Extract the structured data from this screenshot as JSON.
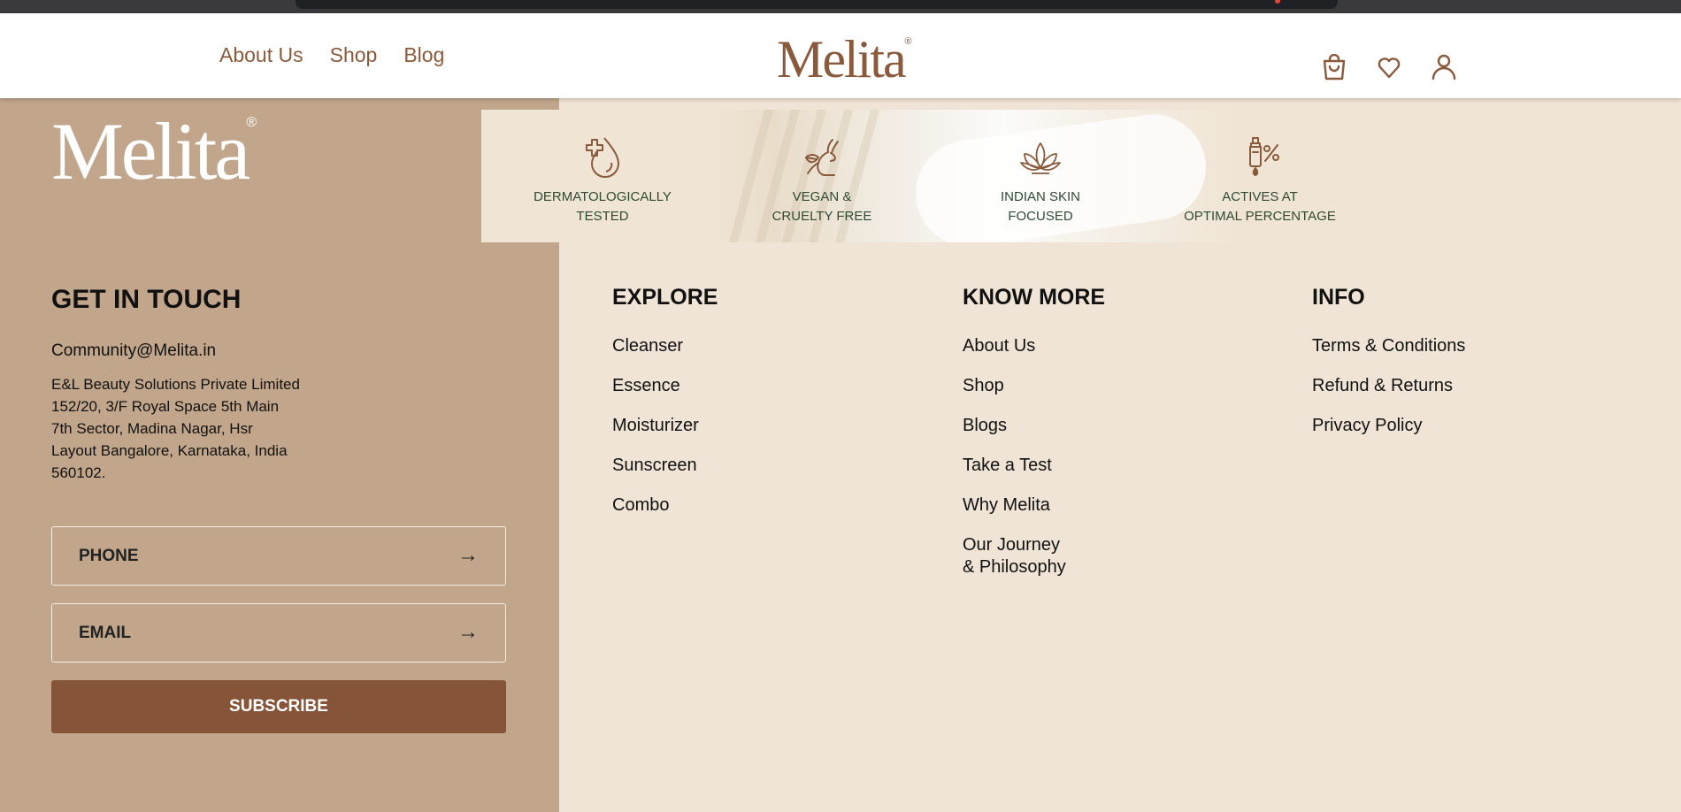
{
  "header": {
    "nav": [
      "About Us",
      "Shop",
      "Blog"
    ],
    "logo": "Melita",
    "logo_mark": "®",
    "icons": [
      "shopping-bag-icon",
      "heart-icon",
      "user-icon"
    ]
  },
  "footer": {
    "logo": "Melita",
    "logo_mark": "®",
    "get_in_touch": {
      "title": "GET IN TOUCH",
      "email": "Community@Melita.in",
      "address": "E&L Beauty Solutions Private Limited\n152/20, 3/F Royal Space 5th Main\n7th Sector, Madina Nagar, Hsr\nLayout Bangalore, Karnataka, India\n560102.",
      "phone_placeholder": "PHONE",
      "email_placeholder": "EMAIL",
      "arrow": "→",
      "subscribe_label": "SUBSCRIBE"
    },
    "badges": [
      {
        "icon": "drop-plus-icon",
        "label": "DERMATOLOGICALLY\nTESTED"
      },
      {
        "icon": "rabbit-icon",
        "label": "VEGAN &\nCRUELTY FREE"
      },
      {
        "icon": "lotus-icon",
        "label": "INDIAN SKIN\nFOCUSED"
      },
      {
        "icon": "dropper-percent-icon",
        "label": "ACTIVES AT\nOPTIMAL PERCENTAGE"
      }
    ],
    "explore": {
      "title": "EXPLORE",
      "links": [
        "Cleanser",
        "Essence",
        "Moisturizer",
        "Sunscreen",
        "Combo"
      ]
    },
    "know_more": {
      "title": "KNOW MORE",
      "links": [
        "About Us",
        "Shop",
        "Blogs",
        "Take a Test",
        "Why Melita",
        "Our Journey\n& Philosophy"
      ]
    },
    "info": {
      "title": "INFO",
      "links": [
        "Terms & Conditions",
        "Refund & Returns",
        "Privacy Policy"
      ]
    }
  },
  "colors": {
    "brand_brown": "#8a5a3c",
    "left_panel": "#c1a68b",
    "page_bg": "#efe4d5",
    "subscribe_bg": "#865439",
    "badge_text": "#2e4a35"
  }
}
